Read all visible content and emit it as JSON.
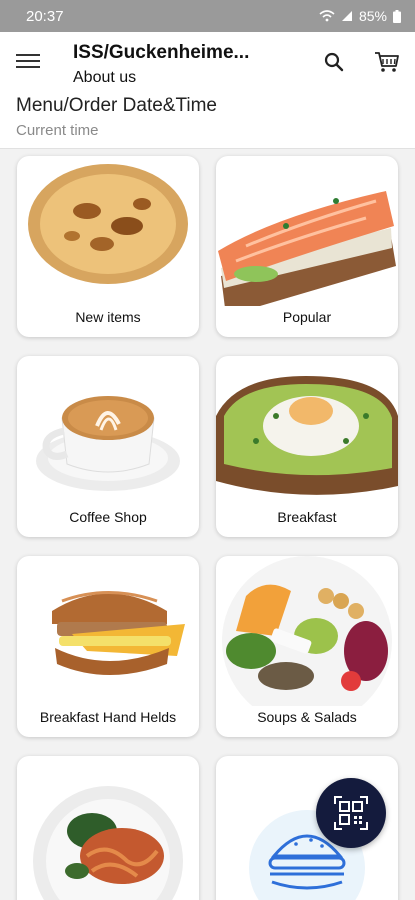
{
  "status": {
    "time": "20:37",
    "battery": "85%"
  },
  "header": {
    "title": "ISS/Guckenheime...",
    "about": "About us"
  },
  "order": {
    "title": "Menu/Order Date&Time",
    "subtitle": "Current time"
  },
  "categories": [
    {
      "label": "New items",
      "icon": "quiche-image"
    },
    {
      "label": "Popular",
      "icon": "salmon-toast-image"
    },
    {
      "label": "Coffee Shop",
      "icon": "latte-image"
    },
    {
      "label": "Breakfast",
      "icon": "avocado-toast-image"
    },
    {
      "label": "Breakfast Hand Helds",
      "icon": "breakfast-sandwich-image"
    },
    {
      "label": "Soups & Salads",
      "icon": "salad-bowl-image"
    },
    {
      "label": "",
      "icon": "pasta-plate-image"
    },
    {
      "label": "",
      "icon": "burger-icon"
    }
  ],
  "colors": {
    "status_bar": "#9a9a9a",
    "fab": "#141b3d"
  }
}
